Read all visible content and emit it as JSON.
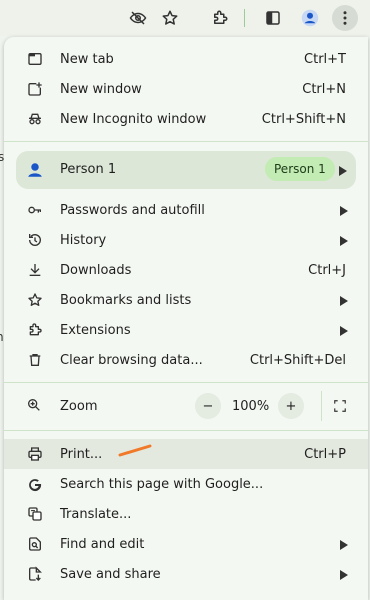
{
  "toolbar": {
    "icons": [
      "eye-off-icon",
      "star-icon",
      "extensions-icon",
      "side-panel-icon",
      "profile-icon",
      "menu-icon"
    ]
  },
  "background": {
    "fragments": [
      "s",
      "n"
    ]
  },
  "menu": {
    "new_tab": {
      "label": "New tab",
      "shortcut": "Ctrl+T"
    },
    "new_window": {
      "label": "New window",
      "shortcut": "Ctrl+N"
    },
    "new_incognito": {
      "label": "New Incognito window",
      "shortcut": "Ctrl+Shift+N"
    },
    "profile": {
      "label": "Person 1",
      "badge": "Person 1"
    },
    "passwords": {
      "label": "Passwords and autofill"
    },
    "history": {
      "label": "History"
    },
    "downloads": {
      "label": "Downloads",
      "shortcut": "Ctrl+J"
    },
    "bookmarks": {
      "label": "Bookmarks and lists"
    },
    "extensions": {
      "label": "Extensions"
    },
    "clear_data": {
      "label": "Clear browsing data...",
      "shortcut": "Ctrl+Shift+Del"
    },
    "zoom": {
      "label": "Zoom",
      "minus": "−",
      "value": "100%",
      "plus": "+"
    },
    "print": {
      "label": "Print...",
      "shortcut": "Ctrl+P"
    },
    "search_google": {
      "label": "Search this page with Google..."
    },
    "translate": {
      "label": "Translate..."
    },
    "find_edit": {
      "label": "Find and edit"
    },
    "save_share": {
      "label": "Save and share"
    }
  },
  "colors": {
    "menu_bg": "#f4f8f2",
    "profile_bg": "#dde7d8",
    "badge_bg": "#c2ecb3",
    "annotation": "#f07a2a"
  }
}
